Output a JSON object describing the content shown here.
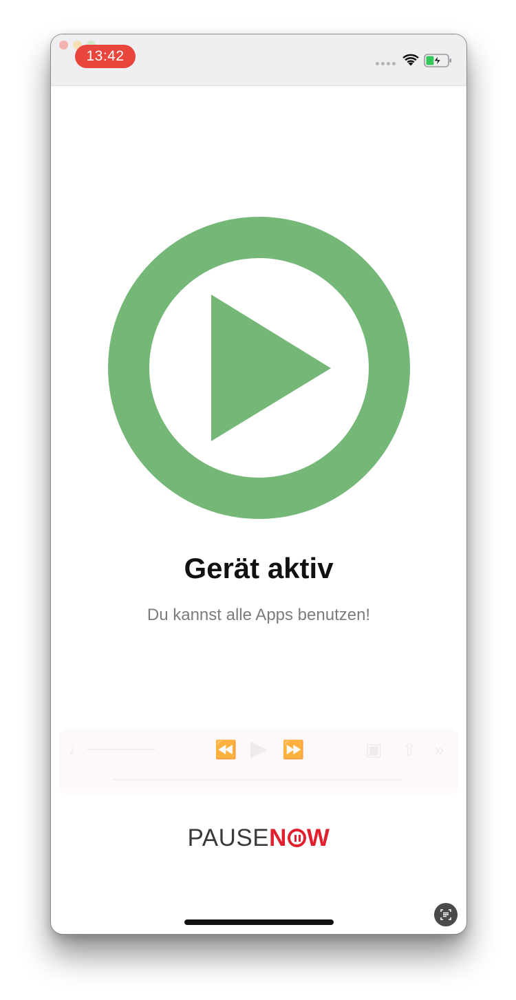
{
  "status_bar": {
    "time": "13:42",
    "wifi_icon": "wifi-icon",
    "battery_icon": "battery-charging-icon",
    "colors": {
      "time_pill": "#e8453c",
      "battery_fill": "#34c759"
    }
  },
  "main": {
    "status_icon": "play-circle-icon",
    "status_color": "#74b777",
    "title": "Gerät aktiv",
    "subtitle": "Du kannst alle Apps benutzen!"
  },
  "brand": {
    "part1": "PAUSE",
    "part2_n": "N",
    "part2_o_icon": "pause-circle-icon",
    "part2_w": "W",
    "colors": {
      "pause": "#3a3a3c",
      "now": "#e0202e"
    }
  },
  "overlay": {
    "scan_icon": "text-scan-icon"
  }
}
